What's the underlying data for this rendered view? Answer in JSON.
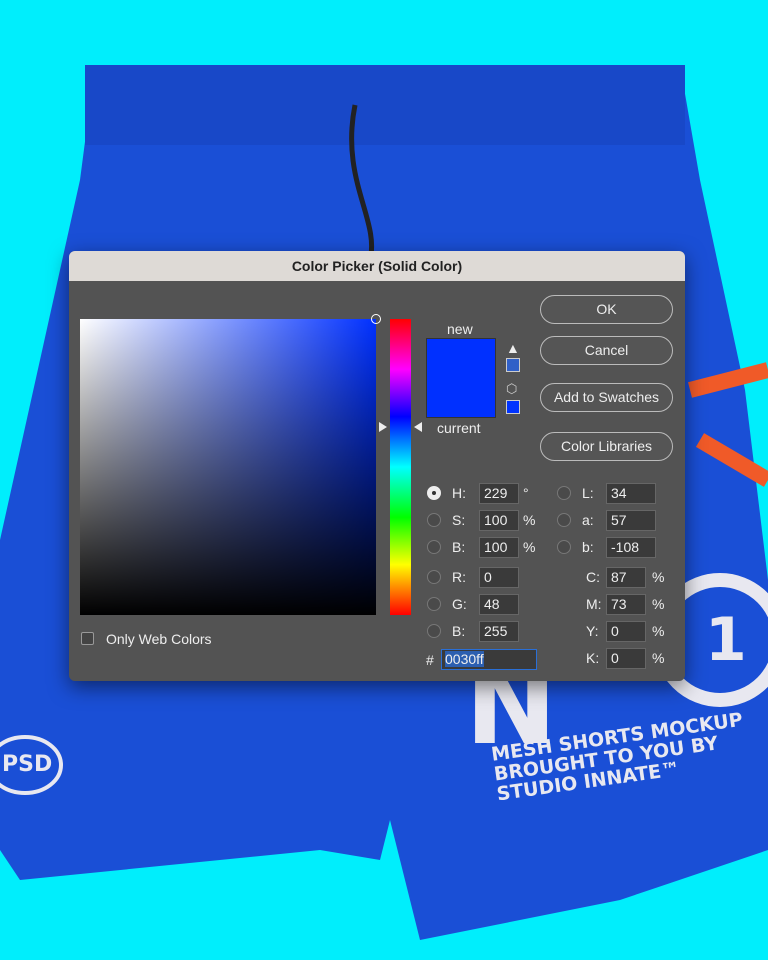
{
  "background": {
    "color": "#00eefc",
    "shorts_color": "#1a4fd6",
    "print_lines": [
      "MESH SHORTS MOCKUP",
      "BROUGHT TO YOU BY",
      "STUDIO INNATE™"
    ],
    "badge": "PSD",
    "number": "N",
    "number_circle": "1"
  },
  "dialog": {
    "title": "Color Picker (Solid Color)",
    "buttons": {
      "ok": "OK",
      "cancel": "Cancel",
      "add_swatches": "Add to Swatches",
      "libraries": "Color Libraries"
    },
    "new_label": "new",
    "current_label": "current",
    "new_color": "#0030ff",
    "current_color": "#0030ff",
    "only_web_colors": "Only Web Colors",
    "only_web_checked": false,
    "hsb": [
      {
        "label": "H:",
        "value": "229",
        "unit": "°",
        "selected": true
      },
      {
        "label": "S:",
        "value": "100",
        "unit": "%"
      },
      {
        "label": "B:",
        "value": "100",
        "unit": "%"
      }
    ],
    "rgb": [
      {
        "label": "R:",
        "value": "0"
      },
      {
        "label": "G:",
        "value": "48"
      },
      {
        "label": "B:",
        "value": "255"
      }
    ],
    "lab": [
      {
        "label": "L:",
        "value": "34"
      },
      {
        "label": "a:",
        "value": "57"
      },
      {
        "label": "b:",
        "value": "-108"
      }
    ],
    "cmyk": [
      {
        "label": "C:",
        "value": "87",
        "unit": "%"
      },
      {
        "label": "M:",
        "value": "73",
        "unit": "%"
      },
      {
        "label": "Y:",
        "value": "0",
        "unit": "%"
      },
      {
        "label": "K:",
        "value": "0",
        "unit": "%"
      }
    ],
    "hex_label": "#",
    "hex": "0030ff"
  }
}
